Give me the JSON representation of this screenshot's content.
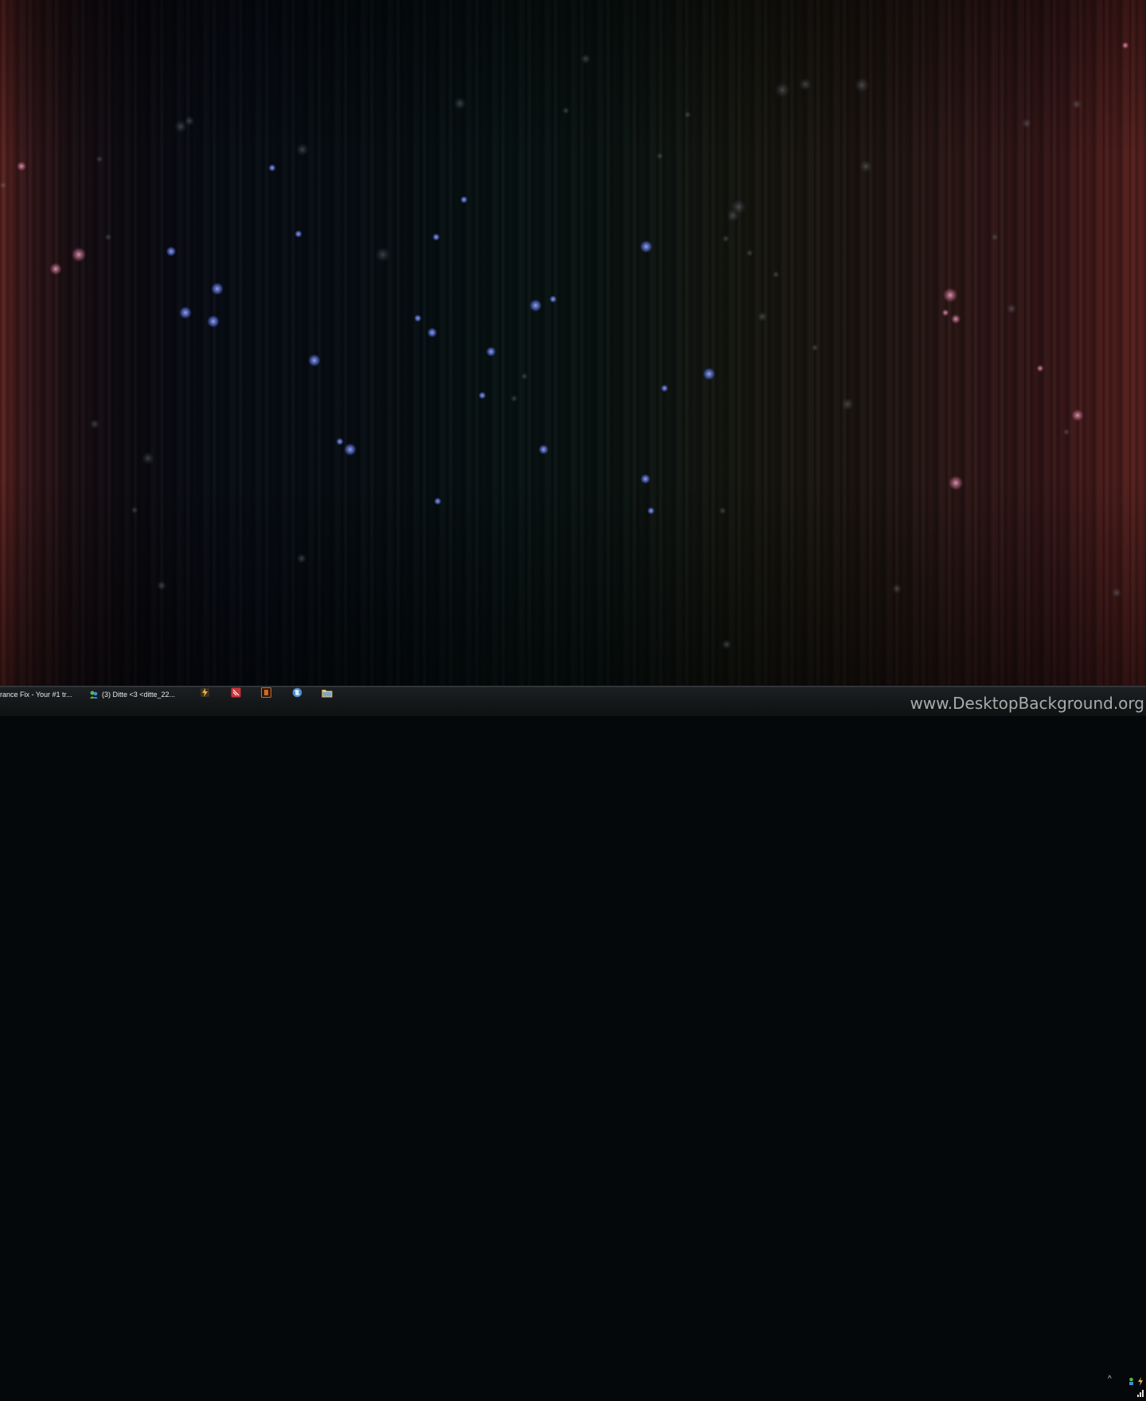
{
  "taskbar": {
    "windows": [
      {
        "label": "rance Fix - Your #1 tr...",
        "icon": "browser-tab-icon"
      },
      {
        "label": "(3) Ditte <3 <ditte_22...",
        "icon": "messenger-icon"
      }
    ],
    "pinned": [
      {
        "icon": "lightning-app-icon",
        "color": "#e8b24a"
      },
      {
        "icon": "red-app-icon",
        "color": "#c9343a"
      },
      {
        "icon": "orange-app-icon",
        "color": "#d06a20"
      },
      {
        "icon": "globe-icon",
        "color": "#4a8fd0"
      },
      {
        "icon": "folder-icon",
        "color": "#e6c46a"
      }
    ],
    "tray": {
      "expand_label": "^",
      "icons": [
        "network-icon",
        "lightning-tray-icon",
        "signal-icon"
      ]
    }
  },
  "watermark": "www.DesktopBackground.org",
  "colors": {
    "taskbar_bg": "#15181a",
    "bokeh_blue": "#6f86ff",
    "bokeh_pink": "#d98aa0"
  }
}
